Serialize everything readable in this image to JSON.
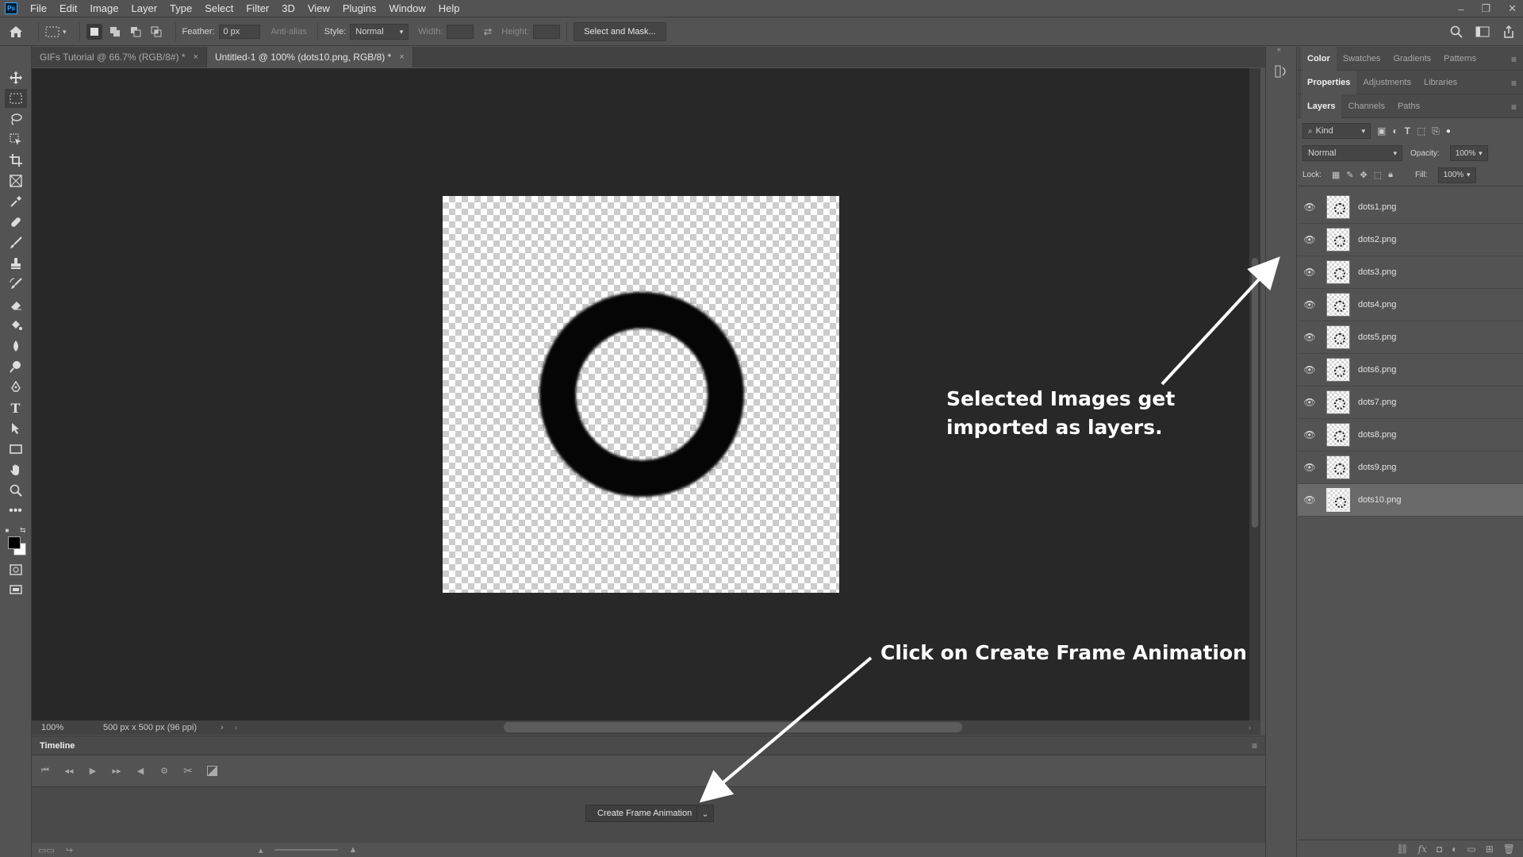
{
  "app": {
    "logo": "Ps",
    "menu": [
      "File",
      "Edit",
      "Image",
      "Layer",
      "Type",
      "Select",
      "Filter",
      "3D",
      "View",
      "Plugins",
      "Window",
      "Help"
    ]
  },
  "options": {
    "feather_label": "Feather:",
    "feather_value": "0 px",
    "antialias_label": "Anti-alias",
    "style_label": "Style:",
    "style_value": "Normal",
    "width_label": "Width:",
    "height_label": "Height:",
    "select_mask_label": "Select and Mask..."
  },
  "tabs": [
    {
      "label": "GIFs Tutorial @ 66.7% (RGB/8#) *",
      "close": "×"
    },
    {
      "label": "Untitled-1 @ 100% (dots10.png, RGB/8) *",
      "close": "×"
    }
  ],
  "status": {
    "zoom": "100%",
    "doc_info": "500 px x 500 px (96 ppi)",
    "arrow": "›"
  },
  "timeline": {
    "title": "Timeline",
    "create_button": "Create Frame Animation",
    "dropdown_arrow": "⌄"
  },
  "panels": {
    "top_tabs": [
      "Color",
      "Swatches",
      "Gradients",
      "Patterns"
    ],
    "mid_tabs": [
      "Properties",
      "Adjustments",
      "Libraries"
    ],
    "layer_tabs": [
      "Layers",
      "Channels",
      "Paths"
    ],
    "kind_label": "Kind",
    "blend_mode": "Normal",
    "opacity_label": "Opacity:",
    "opacity_value": "100%",
    "lock_label": "Lock:",
    "fill_label": "Fill:",
    "fill_value": "100%"
  },
  "layers": [
    {
      "name": "dots1.png"
    },
    {
      "name": "dots2.png"
    },
    {
      "name": "dots3.png"
    },
    {
      "name": "dots4.png"
    },
    {
      "name": "dots5.png"
    },
    {
      "name": "dots6.png"
    },
    {
      "name": "dots7.png"
    },
    {
      "name": "dots8.png"
    },
    {
      "name": "dots9.png"
    },
    {
      "name": "dots10.png"
    }
  ],
  "annotations": {
    "layers_note": "Selected Images get imported as layers.",
    "timeline_note": "Click on Create Frame Animation"
  },
  "colors": {
    "ui_bg": "#535353",
    "canvas_bg": "#282828",
    "selected_layer": "#6a6a6a",
    "ring": "#050505",
    "annotation": "#ffffff"
  }
}
